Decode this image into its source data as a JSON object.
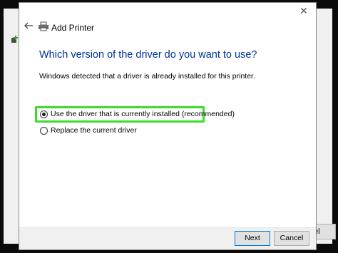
{
  "dialog": {
    "title": "Add Printer",
    "heading": "Which version of the driver do you want to use?",
    "description": "Windows detected that a driver is already installed for this printer.",
    "options": [
      {
        "label": "Use the driver that is currently installed (recommended)",
        "selected": true
      },
      {
        "label": "Replace the current driver",
        "selected": false
      }
    ],
    "buttons": {
      "next": "Next",
      "cancel": "Cancel"
    },
    "close_glyph": "✕"
  },
  "background_window": {
    "cancel_fragment": "el"
  },
  "colors": {
    "heading": "#003399",
    "highlight": "#3cdc2a",
    "accent": "#0078d7"
  },
  "icons": [
    "printer-icon",
    "back-arrow-icon",
    "close-icon",
    "add-device-icon"
  ]
}
